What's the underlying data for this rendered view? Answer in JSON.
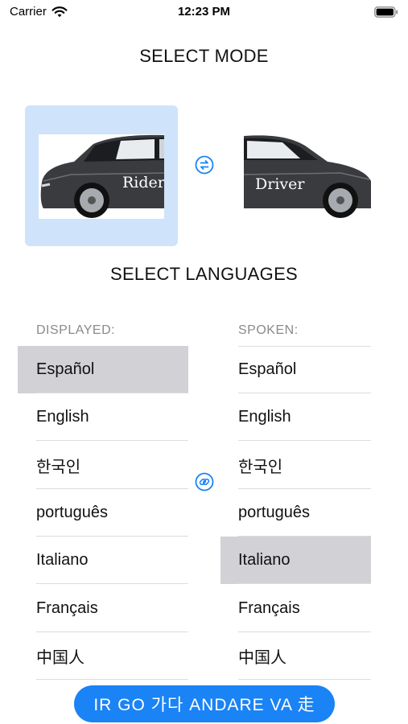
{
  "status_bar": {
    "carrier": "Carrier",
    "time": "12:23 PM",
    "icons": [
      "wifi-icon",
      "battery-icon"
    ]
  },
  "mode_section": {
    "title": "SELECT MODE",
    "modes": [
      {
        "label": "Rider",
        "selected": true
      },
      {
        "label": "Driver",
        "selected": false
      }
    ],
    "swap_icon": "swap-arrows-icon"
  },
  "language_section": {
    "title": "SELECT LANGUAGES",
    "displayed": {
      "header": "DISPLAYED:",
      "items": [
        "Español",
        "English",
        "한국인",
        "português",
        "Italiano",
        "Français",
        "中国人"
      ],
      "selected_index": 0
    },
    "spoken": {
      "header": "SPOKEN:",
      "items": [
        "Español",
        "English",
        "한국인",
        "português",
        "Italiano",
        "Français",
        "中国人"
      ],
      "selected_index": 4
    },
    "link_icon": "link-icon"
  },
  "go_button": {
    "label": "IR  GO  가다  ANDARE  VA  走"
  },
  "colors": {
    "accent": "#1a83f5",
    "selection_blue": "#cfe3fb",
    "selection_gray": "#d1d1d6"
  }
}
